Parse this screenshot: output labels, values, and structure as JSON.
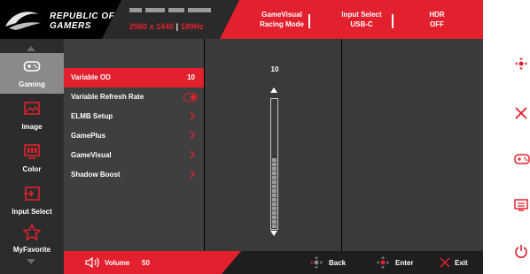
{
  "header": {
    "brand_line1": "REPUBLIC OF",
    "brand_line2": "GAMERS",
    "resolution": "2560 x 1440",
    "refresh": "180Hz",
    "info": [
      {
        "title": "GameVisual",
        "value": "Racing Mode"
      },
      {
        "title": "Input Select",
        "value": "USB-C"
      },
      {
        "title": "HDR",
        "value": "OFF"
      }
    ]
  },
  "sidebar": {
    "items": [
      {
        "label": "Gaming",
        "icon": "gamepad-icon",
        "active": true
      },
      {
        "label": "Image",
        "icon": "image-icon"
      },
      {
        "label": "Color",
        "icon": "color-icon"
      },
      {
        "label": "Input Select",
        "icon": "input-select-icon"
      },
      {
        "label": "MyFavorite",
        "icon": "star-icon"
      }
    ]
  },
  "menu": {
    "items": [
      {
        "label": "Variable OD",
        "value": "10",
        "active": true
      },
      {
        "label": "Variable Refresh Rate",
        "control": "toggle"
      },
      {
        "label": "ELMB Setup",
        "control": "chevron"
      },
      {
        "label": "GamePlus",
        "control": "chevron"
      },
      {
        "label": "GameVisual",
        "control": "chevron"
      },
      {
        "label": "Shadow Boost",
        "control": "chevron"
      }
    ]
  },
  "slider": {
    "value": "10",
    "fill_fraction": 0.55
  },
  "footer": {
    "volume_label": "Volume",
    "volume_value": "50",
    "back": "Back",
    "enter": "Enter",
    "exit": "Exit"
  },
  "colors": {
    "accent": "#e3202e",
    "panel": "#3a3a3a",
    "sidebar": "#2c2c2c"
  }
}
